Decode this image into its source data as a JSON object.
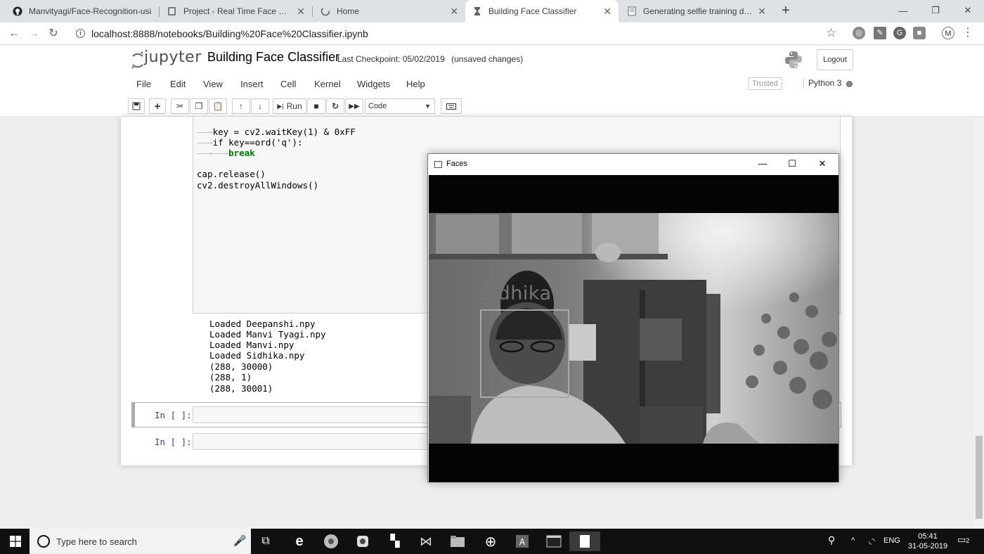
{
  "browser": {
    "tabs": [
      {
        "label": "Manvityagi/Face-Recognition-usi",
        "icon": "github-icon",
        "active": false
      },
      {
        "label": "Project - Real Time Face Recog",
        "icon": "doc-icon",
        "active": false
      },
      {
        "label": "Home",
        "icon": "loading-icon",
        "active": false
      },
      {
        "label": "Building Face Classifier",
        "icon": "hourglass-icon",
        "active": true
      },
      {
        "label": "Generating selfie training data",
        "icon": "notebook-icon",
        "active": false
      }
    ],
    "url": "localhost:8888/notebooks/Building%20Face%20Classifier.ipynb",
    "profile_initial": "M"
  },
  "jupyter": {
    "logo_text": "jupyter",
    "notebook_title": "Building Face Classifier",
    "checkpoint": "Last Checkpoint: 05/02/2019",
    "unsaved": "(unsaved changes)",
    "logout_label": "Logout",
    "menu": [
      "File",
      "Edit",
      "View",
      "Insert",
      "Cell",
      "Kernel",
      "Widgets",
      "Help"
    ],
    "trusted_label": "Trusted",
    "kernel_name": "Python 3",
    "run_label": "Run",
    "cell_type": "Code"
  },
  "cell": {
    "code_lines": [
      {
        "text": "key = cv2.waitKey(1) & 0xFF",
        "indent": 1
      },
      {
        "text": "if key==ord('q'):",
        "indent": 1
      },
      {
        "text": "break",
        "indent": 2
      },
      {
        "text": "",
        "indent": 0
      },
      {
        "text": "cap.release()",
        "indent": 0
      },
      {
        "text": "cv2.destroyAllWindows()",
        "indent": 0
      }
    ],
    "output_lines": [
      "Loaded Deepanshi.npy",
      "Loaded Manvi Tyagi.npy",
      "Loaded Manvi.npy",
      "Loaded Sidhika.npy",
      "(288, 30000)",
      "(288, 1)",
      "(288, 30001)"
    ],
    "empty_prompt_1": "In [ ]:",
    "empty_prompt_2": "In [ ]:"
  },
  "cv_window": {
    "title": "Faces",
    "face_label": "Sidhika"
  },
  "taskbar": {
    "search_placeholder": "Type here to search",
    "language": "ENG",
    "time": "05:41",
    "date": "31-05-2019",
    "notification_count": "2"
  }
}
